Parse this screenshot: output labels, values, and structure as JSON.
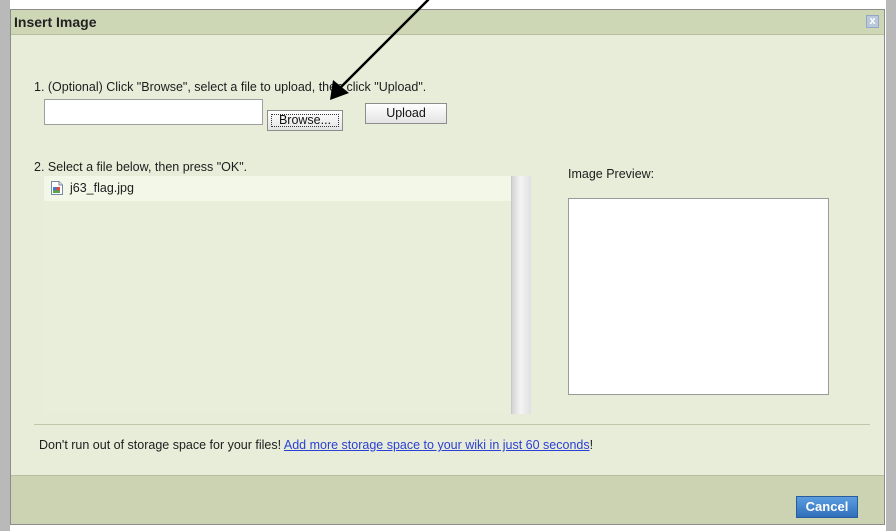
{
  "dialog": {
    "title": "Insert Image",
    "close_glyph": "x"
  },
  "upload_section": {
    "step_text": "1. (Optional) Click \"Browse\", select a file to upload, then click \"Upload\".",
    "file_input_value": "",
    "browse_label": "Browse...",
    "upload_label": "Upload"
  },
  "select_section": {
    "step_text": "2. Select a file below, then press \"OK\".",
    "files": [
      {
        "name": "j63_flag.jpg",
        "icon": "image-file-icon"
      }
    ]
  },
  "preview": {
    "label": "Image Preview:"
  },
  "footer": {
    "promo_prefix": "Don't run out of storage space for your files! ",
    "promo_link": "Add more storage space to your wiki in just 60 seconds",
    "promo_suffix": "!",
    "cancel_label": "Cancel"
  },
  "colors": {
    "dialog_bg": "#e8edd9",
    "titlebar_bg": "#cdd6b5",
    "link": "#2a3fd6",
    "cancel_bg": "#2f6fba"
  }
}
